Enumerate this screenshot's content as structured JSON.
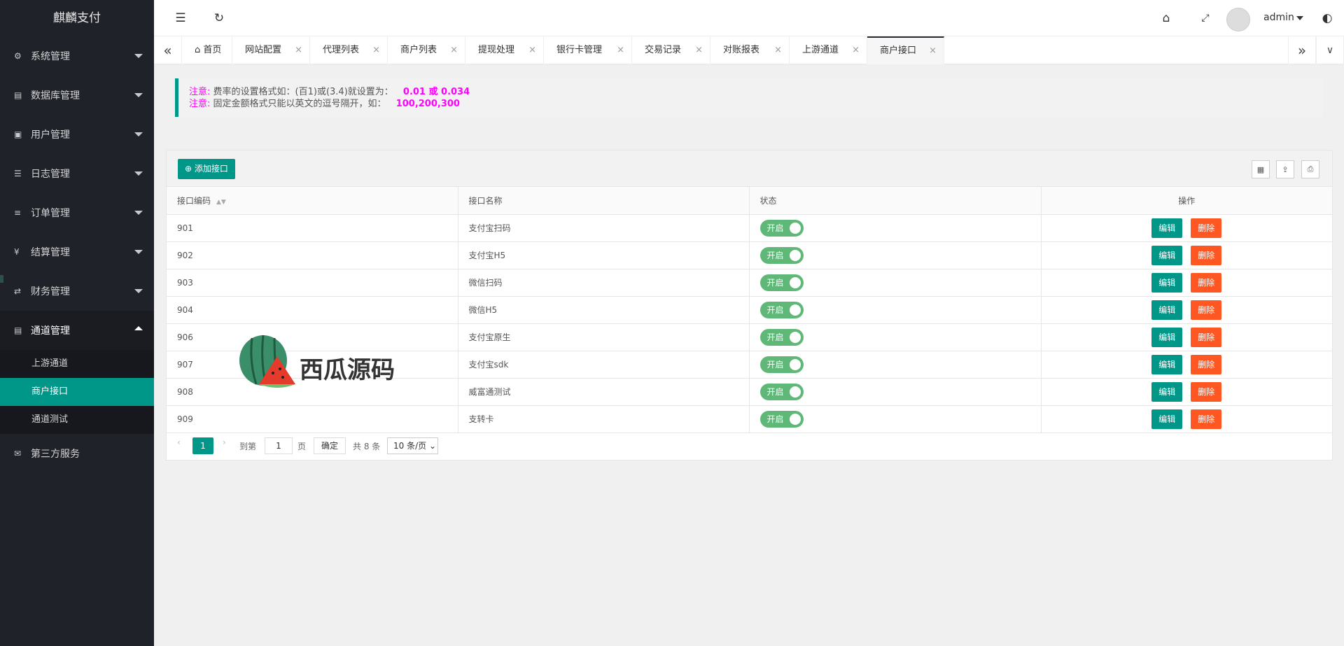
{
  "app": {
    "title": "麒麟支付"
  },
  "sidebar": {
    "items": [
      {
        "label": "系统管理",
        "icon": "gear-icon"
      },
      {
        "label": "数据库管理",
        "icon": "database-icon"
      },
      {
        "label": "用户管理",
        "icon": "users-icon"
      },
      {
        "label": "日志管理",
        "icon": "log-icon"
      },
      {
        "label": "订单管理",
        "icon": "list-icon"
      },
      {
        "label": "结算管理",
        "icon": "yen-icon"
      },
      {
        "label": "财务管理",
        "icon": "exchange-icon"
      },
      {
        "label": "通道管理",
        "icon": "server-icon"
      }
    ],
    "sub_items": [
      "上游通道",
      "商户接口",
      "通道测试"
    ],
    "extra_item": {
      "label": "第三方服务",
      "icon": "mail-icon"
    }
  },
  "header": {
    "user": "admin"
  },
  "tabs": [
    "首页",
    "网站配置",
    "代理列表",
    "商户列表",
    "提现处理",
    "银行卡管理",
    "交易记录",
    "对账报表",
    "上游通道",
    "商户接口"
  ],
  "notice": {
    "label": "注意:",
    "line1_text": "费率的设置格式如：(百1)或(3.4)就设置为：",
    "line1_value": "0.01 或 0.034",
    "line2_text": "固定金额格式只能以英文的逗号隔开，如：",
    "line2_value": "100,200,300"
  },
  "toolbar": {
    "add_label": "添加接口"
  },
  "table": {
    "headers": [
      "接口编码",
      "接口名称",
      "状态",
      "操作"
    ],
    "rows": [
      {
        "code": "901",
        "name": "支付宝扫码",
        "status": "开启"
      },
      {
        "code": "902",
        "name": "支付宝H5",
        "status": "开启"
      },
      {
        "code": "903",
        "name": "微信扫码",
        "status": "开启"
      },
      {
        "code": "904",
        "name": "微信H5",
        "status": "开启"
      },
      {
        "code": "906",
        "name": "支付宝原生",
        "status": "开启"
      },
      {
        "code": "907",
        "name": "支付宝sdk",
        "status": "开启"
      },
      {
        "code": "908",
        "name": "威富通测试",
        "status": "开启"
      },
      {
        "code": "909",
        "name": "支转卡",
        "status": "开启"
      }
    ],
    "edit_label": "编辑",
    "delete_label": "删除"
  },
  "pagination": {
    "current": "1",
    "goto_label": "到第",
    "goto_value": "1",
    "page_label": "页",
    "ok_label": "确定",
    "total": "共 8 条",
    "page_size": "10 条/页"
  },
  "watermark": {
    "text": "西瓜源码"
  },
  "colors": {
    "accent": "#009688",
    "danger": "#ff5722",
    "switch_on": "#5fb878",
    "sidebar_bg": "#20222a",
    "notice_text": "#ff00ff"
  }
}
